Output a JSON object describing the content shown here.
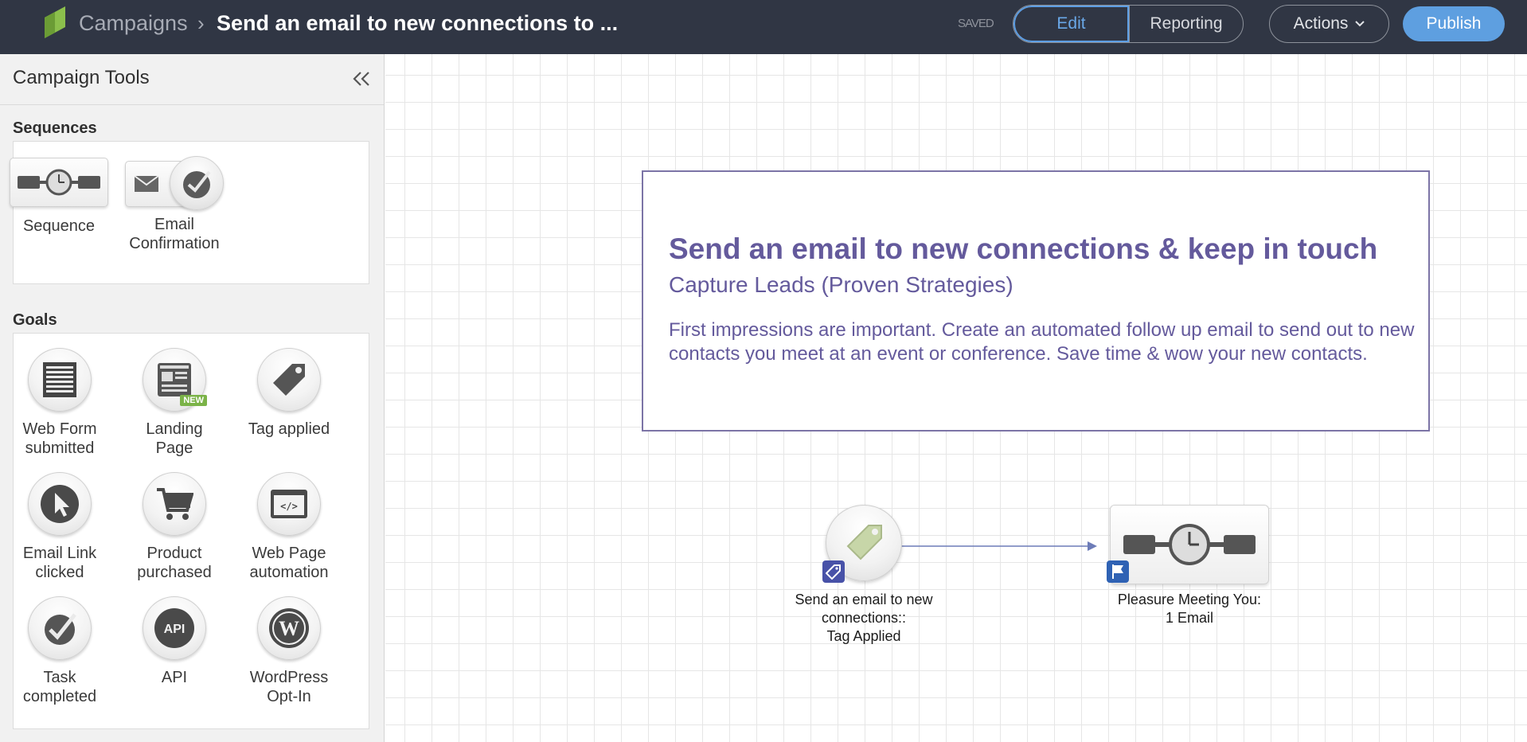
{
  "header": {
    "breadcrumb_root": "Campaigns",
    "breadcrumb_separator": "›",
    "campaign_title": "Send an email to new connections to ...",
    "saved_status": "SAVED",
    "edit_label": "Edit",
    "reporting_label": "Reporting",
    "actions_label": "Actions",
    "publish_label": "Publish"
  },
  "sidebar": {
    "title": "Campaign Tools",
    "sequences_heading": "Sequences",
    "sequences": [
      {
        "label": "Sequence",
        "icon": "sequence-timer-icon"
      },
      {
        "label": "Email\nConfirmation",
        "icon": "email-confirmation-icon"
      }
    ],
    "goals_heading": "Goals",
    "goals": [
      {
        "label": "Web Form\nsubmitted",
        "icon": "web-form-icon"
      },
      {
        "label": "Landing\nPage",
        "icon": "landing-page-icon",
        "badge": "NEW"
      },
      {
        "label": "Tag applied",
        "icon": "tag-icon"
      },
      {
        "label": "Email Link\nclicked",
        "icon": "cursor-icon"
      },
      {
        "label": "Product\npurchased",
        "icon": "cart-icon"
      },
      {
        "label": "Web Page\nautomation",
        "icon": "code-window-icon"
      },
      {
        "label": "Task\ncompleted",
        "icon": "checkmark-icon"
      },
      {
        "label": "API",
        "icon": "api-icon"
      },
      {
        "label": "WordPress\nOpt-In",
        "icon": "wordpress-icon"
      }
    ]
  },
  "canvas": {
    "info": {
      "title": "Send an email to new connections & keep in touch",
      "subtitle": "Capture Leads (Proven Strategies)",
      "description": "First impressions are important. Create an automated follow up email to send out to new contacts you meet at an event or conference. Save time & wow your new contacts."
    },
    "nodes": [
      {
        "label": "Send an email to new connections::\nTag Applied",
        "icon": "tag-icon",
        "badge_icon": "tag-badge-icon"
      },
      {
        "label": "Pleasure Meeting You:\n1 Email",
        "icon": "sequence-timer-icon",
        "badge_icon": "flag-icon"
      }
    ]
  },
  "colors": {
    "topbar": "#303644",
    "accent": "#5e9fe0",
    "info_text": "#645a9c",
    "badge_blue": "#2f62b4",
    "new_badge": "#7bb348"
  }
}
